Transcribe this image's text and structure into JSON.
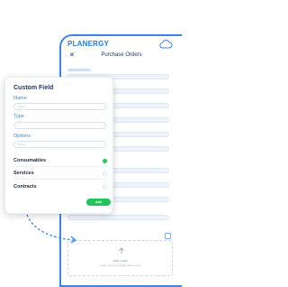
{
  "phone": {
    "logo": "PLANERGY",
    "title": "Purchase Orders",
    "close_glyph": "✕",
    "cloud_icon": "cloud-icon",
    "upload": {
      "line1": "4000 x 2000",
      "line2": "Lorem ipsum is simply dummy text"
    }
  },
  "custom_field": {
    "title": "Custom Field",
    "name_label": "Name",
    "name_placeholder": "Name",
    "type_label": "Type",
    "type_placeholder": "",
    "options_label": "Options",
    "options_placeholder": "Name",
    "options": [
      {
        "label": "Consumables",
        "selected": true
      },
      {
        "label": "Services",
        "selected": false
      },
      {
        "label": "Contracts",
        "selected": false
      }
    ],
    "add_label": "Add"
  },
  "colors": {
    "brand_blue": "#3c86e6",
    "accent_green": "#21c45d",
    "dark_text": "#1f3a66"
  }
}
